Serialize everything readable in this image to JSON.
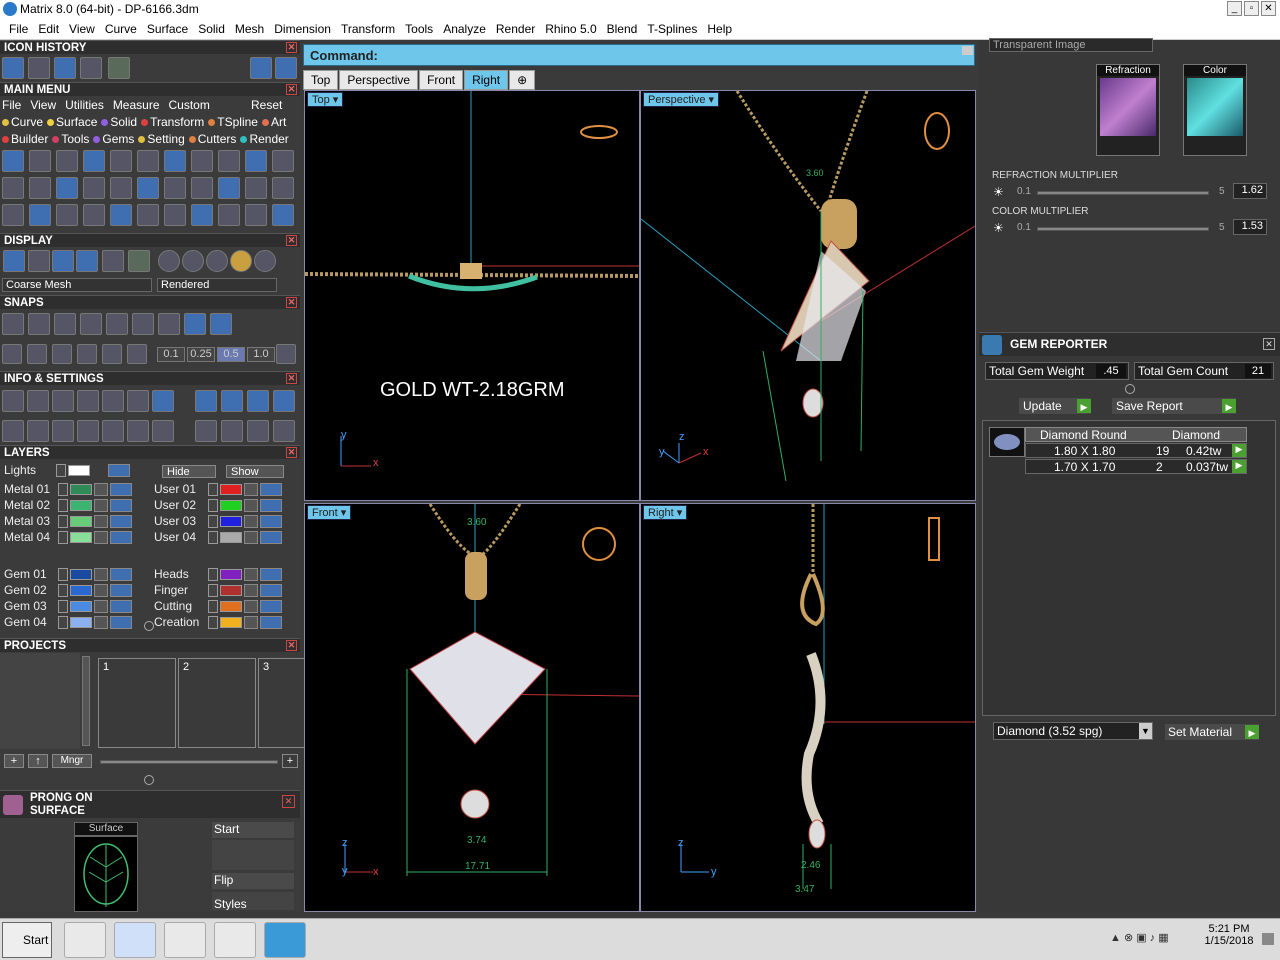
{
  "window": {
    "title": "Matrix 8.0 (64-bit) - DP-6166.3dm"
  },
  "menu": [
    "File",
    "Edit",
    "View",
    "Curve",
    "Surface",
    "Solid",
    "Mesh",
    "Dimension",
    "Transform",
    "Tools",
    "Analyze",
    "Render",
    "Rhino 5.0",
    "Blend",
    "T-Splines",
    "Help"
  ],
  "sections": {
    "icon_history": "ICON HISTORY",
    "main_menu": "MAIN MENU",
    "display": "DISPLAY",
    "snaps": "SNAPS",
    "info": "INFO & SETTINGS",
    "layers": "LAYERS",
    "projects": "PROJECTS",
    "prong": "PRONG ON SURFACE"
  },
  "main_menu": {
    "row1": [
      "File",
      "View",
      "Utilities",
      "Measure",
      "Custom"
    ],
    "reset": "Reset",
    "tabs1": [
      "Curve",
      "Surface",
      "Solid",
      "Transform",
      "TSpline",
      "Art"
    ],
    "tabs2": [
      "Builder",
      "Tools",
      "Gems",
      "Setting",
      "Cutters",
      "Render"
    ]
  },
  "display": {
    "mesh": "Coarse Mesh",
    "mode": "Rendered"
  },
  "snaps": {
    "values": [
      "0.1",
      "0.25",
      "0.5",
      "1.0"
    ]
  },
  "layers": {
    "lights": "Lights",
    "hide": "Hide",
    "show": "Show",
    "left": [
      {
        "name": "Metal 01",
        "color": "#2e8b57"
      },
      {
        "name": "Metal 02",
        "color": "#3cb371"
      },
      {
        "name": "Metal 03",
        "color": "#66cc77"
      },
      {
        "name": "Metal 04",
        "color": "#88dd99"
      },
      {
        "name": "Gem 01",
        "color": "#1a4aa0"
      },
      {
        "name": "Gem 02",
        "color": "#2a6ad0"
      },
      {
        "name": "Gem 03",
        "color": "#4a8ae0"
      },
      {
        "name": "Gem 04",
        "color": "#8ab0f0"
      }
    ],
    "right": [
      {
        "name": "User 01",
        "color": "#e02020"
      },
      {
        "name": "User 02",
        "color": "#20d020"
      },
      {
        "name": "User 03",
        "color": "#2020e0"
      },
      {
        "name": "User 04",
        "color": "#aaaaaa"
      },
      {
        "name": "Heads",
        "color": "#8020c0"
      },
      {
        "name": "Finger",
        "color": "#b03030"
      },
      {
        "name": "Cutting",
        "color": "#e07020"
      },
      {
        "name": "Creation",
        "color": "#f0b020"
      }
    ]
  },
  "projects": {
    "slots": [
      "1",
      "2",
      "3"
    ],
    "mngr": "Mngr"
  },
  "prong": {
    "surface": "Surface",
    "start": "Start",
    "flip": "Flip",
    "styles": "Styles"
  },
  "command": {
    "label": "Command:"
  },
  "viewport_tabs": [
    "Top",
    "Perspective",
    "Front",
    "Right"
  ],
  "viewports": {
    "top": {
      "label": "Top",
      "note": "GOLD WT-2.18GRM"
    },
    "perspective": {
      "label": "Perspective",
      "dim1": "3.60"
    },
    "front": {
      "label": "Front",
      "dim1": "3.60",
      "dim2": "3.74",
      "dim3": "17.71"
    },
    "right": {
      "label": "Right",
      "dim1": "2.46",
      "dim2": "3.47"
    }
  },
  "axes": {
    "x": "x",
    "y": "y",
    "z": "z"
  },
  "render_panel": {
    "image_type": "Transparent Image",
    "refraction": "Refraction",
    "color": "Color",
    "refraction_multiplier": {
      "label": "REFRACTION MULTIPLIER",
      "min": "0.1",
      "max": "5",
      "value": "1.62"
    },
    "color_multiplier": {
      "label": "COLOR MULTIPLIER",
      "min": "0.1",
      "max": "5",
      "value": "1.53"
    }
  },
  "gem_reporter": {
    "title": "GEM REPORTER",
    "weight_label": "Total Gem Weight",
    "weight": ".45",
    "count_label": "Total Gem Count",
    "count": "21",
    "update": "Update",
    "save": "Save Report",
    "header": [
      "Diamond Round",
      "Diamond"
    ],
    "rows": [
      {
        "size": "1.80 X 1.80",
        "count": "19",
        "tw": "0.42tw"
      },
      {
        "size": "1.70 X 1.70",
        "count": "2",
        "tw": "0.037tw"
      }
    ],
    "material": "Diamond      (3.52 spg)",
    "set_material": "Set Material"
  },
  "taskbar": {
    "start": "Start",
    "time": "5:21 PM",
    "date": "1/15/2018"
  }
}
